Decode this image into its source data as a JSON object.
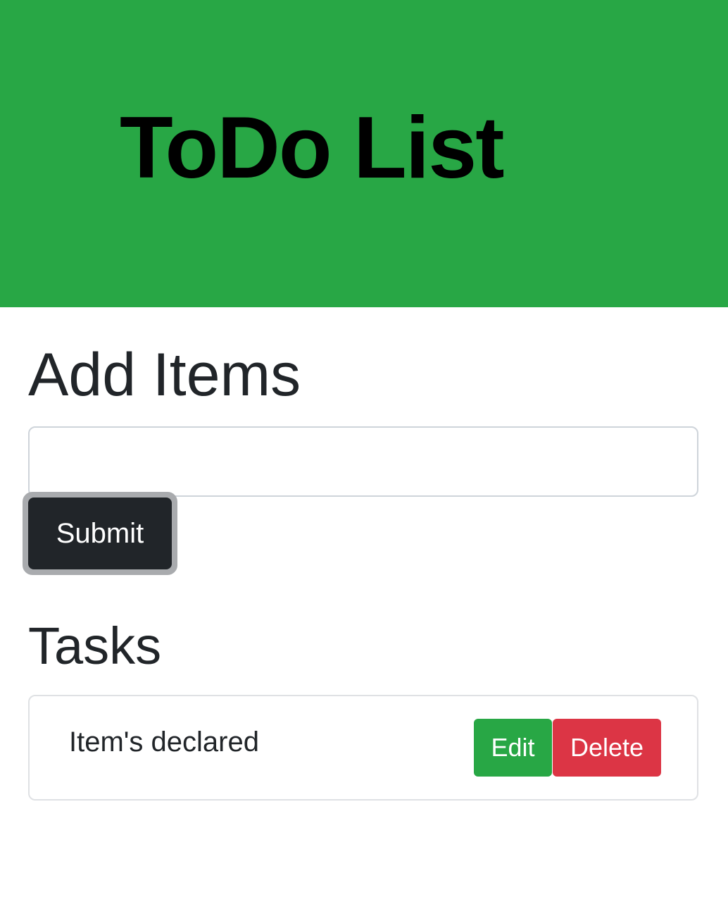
{
  "header": {
    "title": "ToDo List"
  },
  "add_section": {
    "heading": "Add Items",
    "input_value": "",
    "input_placeholder": "",
    "submit_label": "Submit"
  },
  "tasks_section": {
    "heading": "Tasks",
    "items": [
      {
        "text": "Item's declared",
        "edit_label": "Edit",
        "delete_label": "Delete"
      }
    ]
  },
  "colors": {
    "header_bg": "#28a745",
    "submit_bg": "#212529",
    "edit_bg": "#28a745",
    "delete_bg": "#dc3545"
  }
}
